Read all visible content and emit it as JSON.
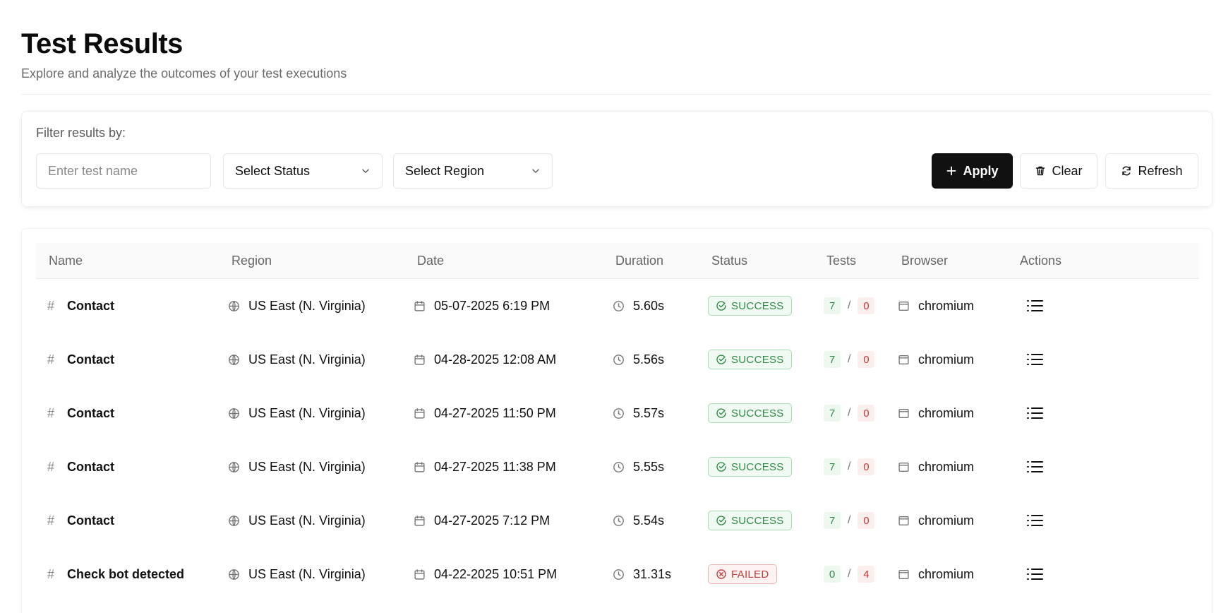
{
  "header": {
    "title": "Test Results",
    "subtitle": "Explore and analyze the outcomes of your test executions"
  },
  "filters": {
    "label": "Filter results by:",
    "name_placeholder": "Enter test name",
    "name_value": "",
    "status_select": "Select Status",
    "region_select": "Select Region",
    "apply_label": "Apply",
    "clear_label": "Clear",
    "refresh_label": "Refresh"
  },
  "table": {
    "columns": [
      "Name",
      "Region",
      "Date",
      "Duration",
      "Status",
      "Tests",
      "Browser",
      "Actions"
    ],
    "rows": [
      {
        "name": "Contact",
        "region": "US East (N. Virginia)",
        "date": "05-07-2025 6:19 PM",
        "duration": "5.60s",
        "status": "SUCCESS",
        "status_kind": "success",
        "passed": "7",
        "failed": "0",
        "browser": "chromium"
      },
      {
        "name": "Contact",
        "region": "US East (N. Virginia)",
        "date": "04-28-2025 12:08 AM",
        "duration": "5.56s",
        "status": "SUCCESS",
        "status_kind": "success",
        "passed": "7",
        "failed": "0",
        "browser": "chromium"
      },
      {
        "name": "Contact",
        "region": "US East (N. Virginia)",
        "date": "04-27-2025 11:50 PM",
        "duration": "5.57s",
        "status": "SUCCESS",
        "status_kind": "success",
        "passed": "7",
        "failed": "0",
        "browser": "chromium"
      },
      {
        "name": "Contact",
        "region": "US East (N. Virginia)",
        "date": "04-27-2025 11:38 PM",
        "duration": "5.55s",
        "status": "SUCCESS",
        "status_kind": "success",
        "passed": "7",
        "failed": "0",
        "browser": "chromium"
      },
      {
        "name": "Contact",
        "region": "US East (N. Virginia)",
        "date": "04-27-2025 7:12 PM",
        "duration": "5.54s",
        "status": "SUCCESS",
        "status_kind": "success",
        "passed": "7",
        "failed": "0",
        "browser": "chromium"
      },
      {
        "name": "Check bot detected",
        "region": "US East (N. Virginia)",
        "date": "04-22-2025 10:51 PM",
        "duration": "31.31s",
        "status": "FAILED",
        "status_kind": "failed",
        "passed": "0",
        "failed": "4",
        "browser": "chromium"
      }
    ]
  },
  "colors": {
    "primary_button": "#111111",
    "success": "#2e8a45",
    "failed": "#c53a3a"
  },
  "icons": {
    "apply": "plus-icon",
    "clear": "trash-icon",
    "refresh": "refresh-icon",
    "name": "hash-icon",
    "region": "globe-icon",
    "date": "calendar-icon",
    "duration": "clock-icon",
    "success": "check-circle-icon",
    "failed": "x-circle-icon",
    "browser": "browser-window-icon",
    "action": "list-icon"
  }
}
